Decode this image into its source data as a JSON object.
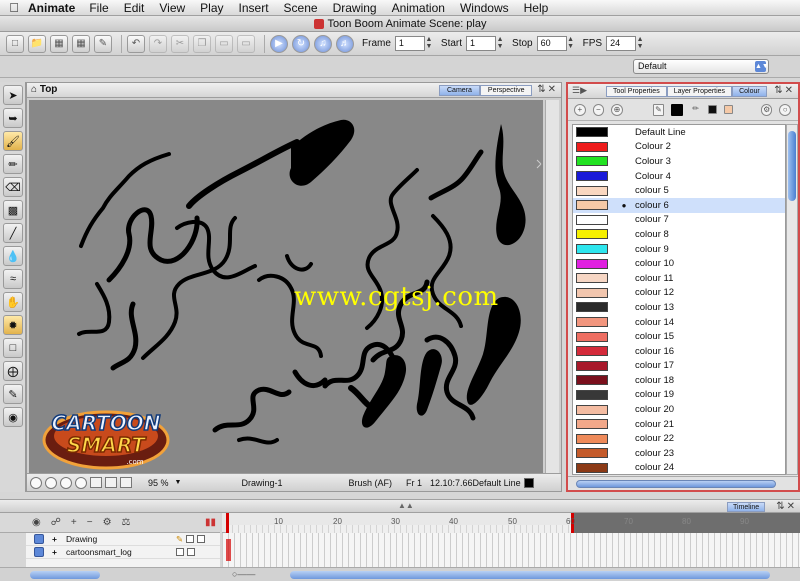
{
  "menubar": {
    "app": "Animate",
    "items": [
      "File",
      "Edit",
      "View",
      "Play",
      "Insert",
      "Scene",
      "Drawing",
      "Animation",
      "Windows",
      "Help"
    ]
  },
  "window": {
    "title": "Toon Boom Animate Scene: play"
  },
  "playback": {
    "frame_label": "Frame",
    "frame_value": "1",
    "start_label": "Start",
    "start_value": "1",
    "stop_label": "Stop",
    "stop_value": "60",
    "fps_label": "FPS",
    "fps_value": "24"
  },
  "workspace": {
    "selected": "Default"
  },
  "view": {
    "title": "Top",
    "tabs": [
      "Camera",
      "Perspective"
    ],
    "active_tab": "Camera",
    "zoom": "95 %",
    "drawing_name": "Drawing-1",
    "tool_status": "Brush (AF)",
    "frame_status": "Fr 1",
    "coords": "12.10:7.66",
    "line_label": "Default Line"
  },
  "watermark": "www.cgtsj.com",
  "logo": {
    "line1": "CARTOON",
    "line2": "SMART",
    "line3": ".com"
  },
  "properties": {
    "tabs": [
      "Tool Properties",
      "Layer Properties",
      "Colour"
    ],
    "active_tab": "Colour",
    "selected_index": 5,
    "colors": [
      {
        "name": "Default Line",
        "hex": "#000000"
      },
      {
        "name": "Colour 2",
        "hex": "#ee1c1c"
      },
      {
        "name": "Colour 3",
        "hex": "#22e222"
      },
      {
        "name": "Colour 4",
        "hex": "#1a1ad8"
      },
      {
        "name": "colour 5",
        "hex": "#f9d7c0"
      },
      {
        "name": "colour 6",
        "hex": "#f5c9a7"
      },
      {
        "name": "colour 7",
        "hex": "#ffffff"
      },
      {
        "name": "colour 8",
        "hex": "#f6f000"
      },
      {
        "name": "colour 9",
        "hex": "#2ee6ee"
      },
      {
        "name": "colour 10",
        "hex": "#e020e0"
      },
      {
        "name": "colour 11",
        "hex": "#f6d6c4"
      },
      {
        "name": "colour 12",
        "hex": "#f2c6ae"
      },
      {
        "name": "colour 13",
        "hex": "#2a2a2a"
      },
      {
        "name": "colour 14",
        "hex": "#f2967e"
      },
      {
        "name": "colour 15",
        "hex": "#ee6e62"
      },
      {
        "name": "colour 16",
        "hex": "#d42a3a"
      },
      {
        "name": "colour 17",
        "hex": "#a8182a"
      },
      {
        "name": "colour 18",
        "hex": "#7a0f1c"
      },
      {
        "name": "colour 19",
        "hex": "#383838"
      },
      {
        "name": "colour 20",
        "hex": "#f4bca2"
      },
      {
        "name": "colour 21",
        "hex": "#f2a88a"
      },
      {
        "name": "colour 22",
        "hex": "#ee8a5a"
      },
      {
        "name": "colour 23",
        "hex": "#c45a2a"
      },
      {
        "name": "colour 24",
        "hex": "#8c3a16"
      }
    ]
  },
  "timeline": {
    "tab": "Timeline",
    "layers": [
      "Drawing",
      "cartoonsmart_log"
    ],
    "ruler": [
      "10",
      "20",
      "30",
      "40",
      "50",
      "60",
      "70",
      "80",
      "90"
    ]
  }
}
